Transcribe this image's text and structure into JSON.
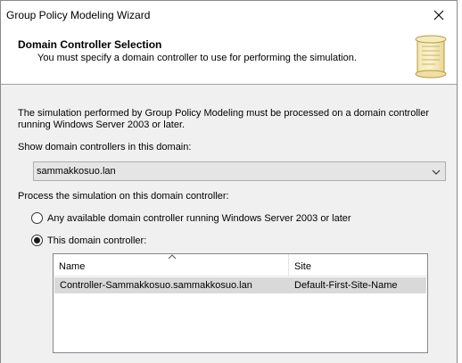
{
  "window": {
    "title": "Group Policy Modeling Wizard"
  },
  "header": {
    "title": "Domain Controller Selection",
    "subtitle": "You must specify a domain controller to use for performing the simulation."
  },
  "intro_text": "The simulation performed by Group Policy Modeling must be processed on a domain controller running Windows Server 2003 or later.",
  "domain_label": "Show domain controllers in this domain:",
  "domain_select": {
    "value": "sammakkosuo.lan"
  },
  "process_label": "Process the simulation on this domain controller:",
  "radios": {
    "any": "Any available domain controller running Windows Server 2003 or later",
    "this": "This domain controller:",
    "selected": "this"
  },
  "table": {
    "columns": [
      "Name",
      "Site"
    ],
    "rows": [
      {
        "name": "Controller-Sammakkosuo.sammakkosuo.lan",
        "site": "Default-First-Site-Name"
      }
    ]
  },
  "colors": {
    "window_bg": "#f0f0f0",
    "selected_row": "#d9d9d9",
    "combo_bg": "#e5e5e5"
  }
}
